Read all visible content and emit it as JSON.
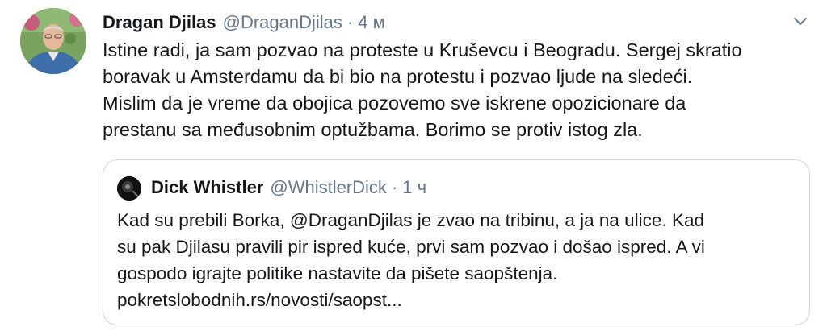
{
  "tweet": {
    "author_name": "Dragan Djilas",
    "author_handle": "@DraganDjilas",
    "separator": "·",
    "time": "4 м",
    "text_lines": [
      "Istine radi, ja sam pozvao na proteste u Kruševcu i Beogradu. Sergej skratio",
      "boravak u Amsterdamu da bi bio na protestu i pozvao ljude na sledeći.",
      "Mislim da je vreme da obojica pozovemo sve iskrene opozicionare da",
      "prestanu sa međusobnim optužbama. Borimo se protiv istog zla."
    ],
    "menu_icon": "chevron-down-icon"
  },
  "quoted_tweet": {
    "author_name": "Dick Whistler",
    "author_handle": "@WhistlerDick",
    "separator": "·",
    "time": "1 ч",
    "text_lines": [
      "Kad su prebili Borka, @DraganDjilas je zvao na tribinu, a ja na ulice. Kad",
      "su pak Djilasu pravili pir ispred kuće, prvi sam pozvao i došao ispred. A vi",
      "gospodo igrajte politike nastavite da pišete saopštenja.",
      "pokretslobodnih.rs/novosti/saopst..."
    ]
  },
  "colors": {
    "text_primary": "#14171a",
    "text_secondary": "#657786",
    "border": "#ccd6dd"
  }
}
